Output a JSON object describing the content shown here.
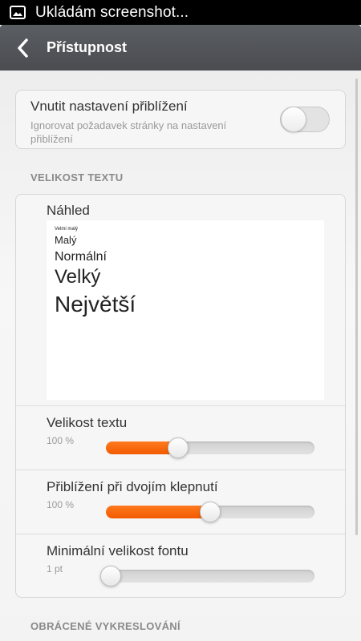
{
  "status_bar": {
    "text": "Ukládám screenshot..."
  },
  "action_bar": {
    "title": "Přístupnost"
  },
  "zoom_setting": {
    "title": "Vnutit nastavení přiblížení",
    "subtitle": "Ignorovat požadavek stránky na nastavení přiblížení",
    "enabled": false
  },
  "text_size_section": {
    "header": "VELIKOST TEXTU",
    "preview_label": "Náhled",
    "preview_items": [
      "Velmi malý",
      "Malý",
      "Normální",
      "Velký",
      "Největší"
    ],
    "sliders": [
      {
        "title": "Velikost textu",
        "value": "100 %",
        "level": 0.34
      },
      {
        "title": "Přiblížení při dvojím klepnutí",
        "value": "100 %",
        "level": 0.5
      },
      {
        "title": "Minimální velikost fontu",
        "value": "1 pt",
        "level": 0.0
      }
    ]
  },
  "inverted_section": {
    "header": "OBRÁCENÉ VYKRESLOVÁNÍ"
  },
  "colors": {
    "accent": "#f25a00",
    "action_bar": "#505357"
  }
}
